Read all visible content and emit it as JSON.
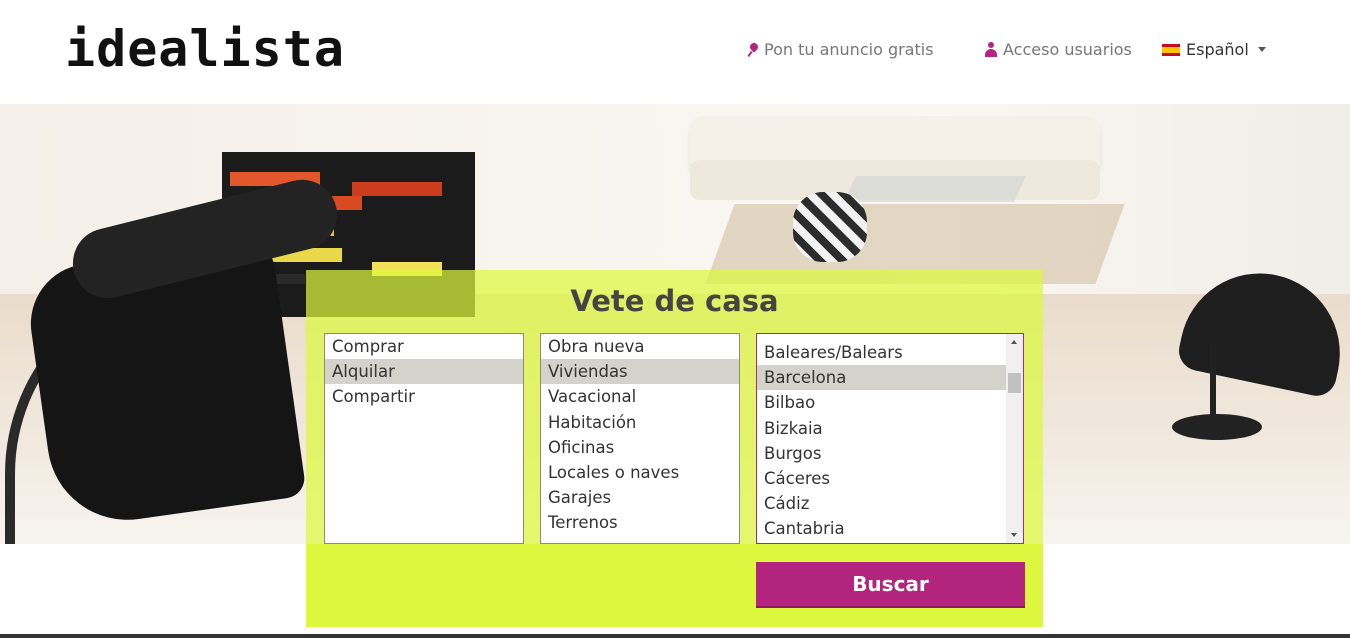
{
  "header": {
    "logo": "idealista",
    "nav": {
      "post_ad": "Pon tu anuncio gratis",
      "login": "Acceso usuarios",
      "language": "Español"
    },
    "icons": {
      "post_ad": "pin-icon",
      "login": "user-icon",
      "language": "spain-flag-icon"
    },
    "accent_color": "#b3257f"
  },
  "search": {
    "title": "Vete de casa",
    "operation_options": [
      "Comprar",
      "Alquilar",
      "Compartir"
    ],
    "operation_selected": "Alquilar",
    "type_options": [
      "Obra nueva",
      "Viviendas",
      "Vacacional",
      "Habitación",
      "Oficinas",
      "Locales o naves",
      "Garajes",
      "Terrenos"
    ],
    "type_selected": "Viviendas",
    "location_options": [
      "Baleares/Balears",
      "Barcelona",
      "Bilbao",
      "Bizkaia",
      "Burgos",
      "Cáceres",
      "Cádiz",
      "Cantabria"
    ],
    "location_selected": "Barcelona",
    "button_label": "Buscar",
    "panel_color": "#ddf73f",
    "button_color": "#b3247e"
  }
}
